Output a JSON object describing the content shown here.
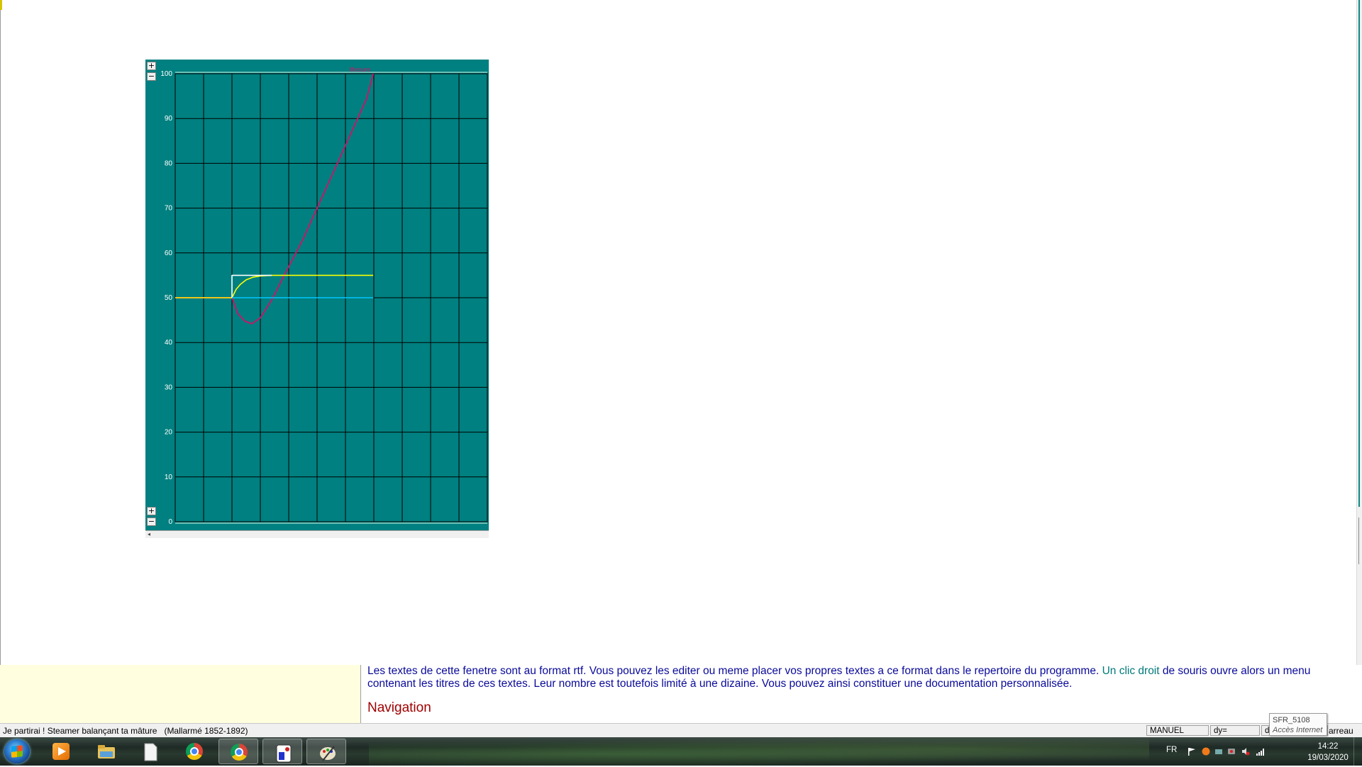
{
  "chart": {
    "legend_label": "Mesure",
    "zoom": {
      "plus": "+",
      "minus": "−"
    }
  },
  "chart_data": {
    "type": "line",
    "ylim": [
      0,
      100
    ],
    "y_ticks": [
      "100",
      "90",
      "80",
      "70",
      "60",
      "50",
      "40",
      "30",
      "20",
      "10",
      "0"
    ],
    "x_range": [
      0,
      11
    ],
    "grid": true,
    "background": "#008080",
    "series": [
      {
        "name": "Mesure",
        "color": "#c01a6a",
        "points": [
          [
            0,
            50
          ],
          [
            2,
            50
          ],
          [
            2.2,
            46.5
          ],
          [
            2.45,
            44.8
          ],
          [
            2.7,
            44.2
          ],
          [
            3.0,
            45.5
          ],
          [
            3.4,
            49.5
          ],
          [
            3.8,
            54.5
          ],
          [
            4.5,
            63
          ],
          [
            5,
            70
          ],
          [
            5.5,
            77
          ],
          [
            6,
            84
          ],
          [
            6.5,
            91
          ],
          [
            6.75,
            94.5
          ],
          [
            6.98,
            100
          ]
        ]
      },
      {
        "color": "#ffff00",
        "points": [
          [
            0,
            50
          ],
          [
            2,
            50
          ],
          [
            2.15,
            51.9
          ],
          [
            2.3,
            53.0
          ],
          [
            2.5,
            54.0
          ],
          [
            2.75,
            54.6
          ],
          [
            3.0,
            54.85
          ],
          [
            3.4,
            55
          ],
          [
            6.98,
            55
          ]
        ]
      },
      {
        "color": "#ffffff",
        "points": [
          [
            2,
            50
          ],
          [
            2,
            55
          ],
          [
            3.4,
            55
          ]
        ]
      },
      {
        "color": "#00c8ff",
        "points": [
          [
            2,
            50
          ],
          [
            6.98,
            50
          ]
        ]
      }
    ]
  },
  "info": {
    "line1_a": "Les textes de cette fenetre sont au format rtf. Vous pouvez les editer ou meme placer vos propres textes a ce format dans le repertoire du programme. ",
    "line1_link": "Un clic droit",
    "line1_b": " de souris ouvre alors un menu",
    "line2": "contenant les titres de ces textes. Leur nombre est toutefois limité à une dizaine. Vous pouvez ainsi constituer une documentation personnalisée.",
    "nav_heading": "Navigation"
  },
  "status": {
    "quote": "Je partirai ! Steamer balançant ta mâture   (Mallarmé 1852-1892)",
    "mode": "MANUEL",
    "dy": "dy=",
    "dt": "dt",
    "tail": "arreau"
  },
  "tooltip": {
    "title": "SFR_5108",
    "subtitle": "Accès Internet"
  },
  "taskbar": {
    "lang": "FR",
    "time": "14:22",
    "date": "19/03/2020"
  },
  "colors": {
    "chart_bg": "#008080",
    "panel_bg": "#ffffe0",
    "info_text": "#0a0a9a",
    "heading": "#a00000"
  }
}
